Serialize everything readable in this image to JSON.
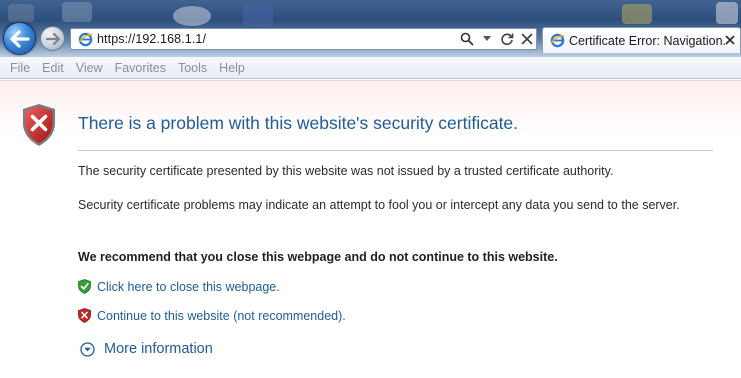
{
  "browser": {
    "url": "https://192.168.1.1/",
    "tab_title": "Certificate Error: Navigation...",
    "menu": [
      "File",
      "Edit",
      "View",
      "Favorites",
      "Tools",
      "Help"
    ]
  },
  "page": {
    "heading": "There is a problem with this website's security certificate.",
    "paragraph_1": "The security certificate presented by this website was not issued by a trusted certificate authority.",
    "paragraph_2": "Security certificate problems may indicate an attempt to fool you or intercept any data you send to the server.",
    "recommendation": "We recommend that you close this webpage and do not continue to this website.",
    "close_link": "Click here to close this webpage.",
    "continue_link": "Continue to this website (not recommended).",
    "more_info": "More information"
  },
  "colors": {
    "link": "#1f5c9a",
    "shield_red": "#c0282a",
    "shield_green": "#3a9b3a"
  },
  "icons": {
    "back": "back-arrow-icon",
    "forward": "forward-arrow-icon",
    "site": "ie-page-icon",
    "search": "search-icon",
    "refresh": "refresh-icon",
    "stop": "stop-icon",
    "error_shield": "shield-error-icon",
    "ok_shield": "shield-check-icon",
    "more_info": "expand-down-icon"
  }
}
